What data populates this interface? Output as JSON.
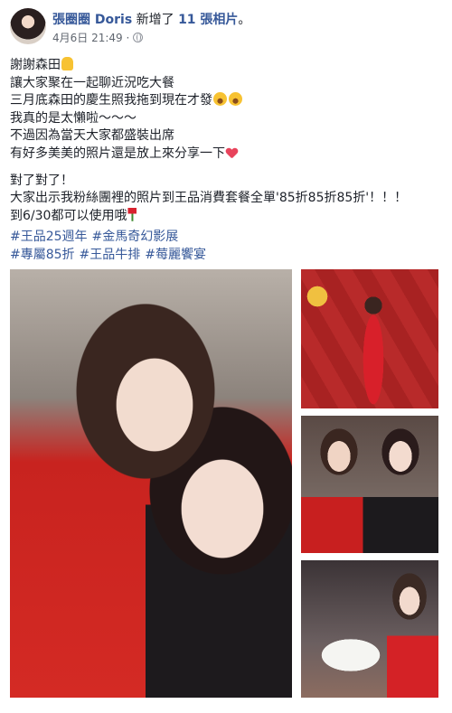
{
  "post": {
    "author": "張圈圈 Doris",
    "action_text": "新增了",
    "photo_count_text": "11 張相片",
    "end_mark": "。",
    "timestamp": "4月6日 21:49 ·",
    "privacy_icon": "globe-icon",
    "text_block_1": [
      "謝謝森田",
      "讓大家聚在一起聊近況吃大餐",
      "三月底森田的慶生照我拖到現在才發",
      "我真的是太懶啦～～～",
      "不過因為當天大家都盛裝出席",
      "有好多美美的照片還是放上來分享一下"
    ],
    "text_block_2": [
      "對了對了！",
      "大家出示我粉絲團裡的照片到王品消費套餐全單'85折85折85折'！！！",
      "到6/30都可以使用哦"
    ],
    "hashtags_line_1": [
      "#王品25週年",
      "#金馬奇幻影展"
    ],
    "hashtags_line_2": [
      "#專屬85折",
      "#王品牛排",
      "#莓麗饗宴"
    ]
  },
  "colors": {
    "link": "#365899",
    "text": "#1d2129",
    "meta": "#616770"
  }
}
